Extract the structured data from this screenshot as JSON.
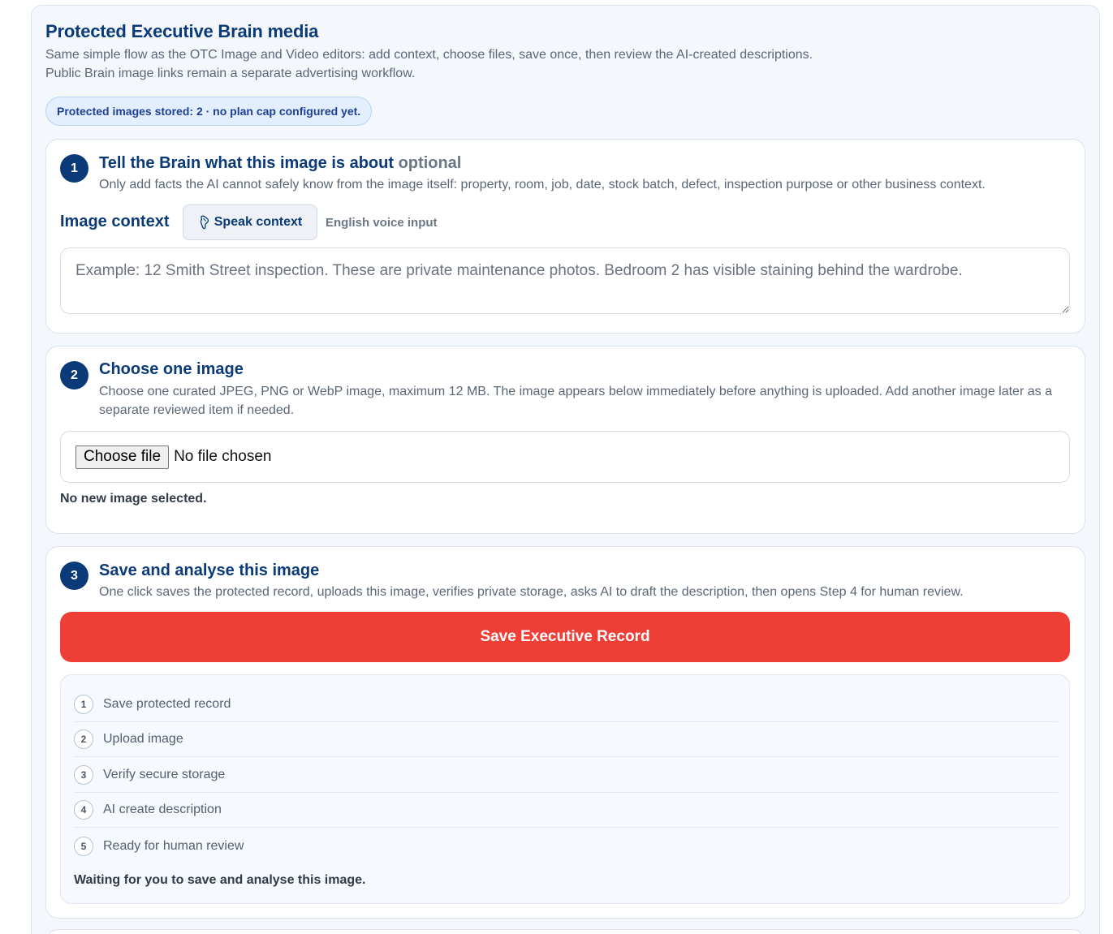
{
  "header": {
    "title": "Protected Executive Brain media",
    "intro": "Same simple flow as the OTC Image and Video editors: add context, choose files, save once, then review the AI-created descriptions. Public Brain image links remain a separate advertising workflow.",
    "status_pill": "Protected images stored: 2 · no plan cap configured yet."
  },
  "step1": {
    "number": "1",
    "title": "Tell the Brain what this image is about",
    "optional": "optional",
    "description": "Only add facts the AI cannot safely know from the image itself: property, room, job, date, stock batch, defect, inspection purpose or other business context.",
    "context_label": "Image context",
    "speak_button": "Speak context",
    "voice_label": "English voice input",
    "textarea_placeholder": "Example: 12 Smith Street inspection. These are private maintenance photos. Bedroom 2 has visible staining behind the wardrobe."
  },
  "step2": {
    "number": "2",
    "title": "Choose one image",
    "description": "Choose one curated JPEG, PNG or WebP image, maximum 12 MB. The image appears below immediately before anything is uploaded. Add another image later as a separate reviewed item if needed.",
    "file_button": "Choose file",
    "file_status": "No file chosen",
    "selection_status": "No new image selected."
  },
  "step3": {
    "number": "3",
    "title": "Save and analyse this image",
    "description": "One click saves the protected record, uploads this image, verifies private storage, asks AI to draft the description, then opens Step 4 for human review.",
    "save_button": "Save Executive Record",
    "progress": [
      {
        "num": "1",
        "label": "Save protected record"
      },
      {
        "num": "2",
        "label": "Upload image"
      },
      {
        "num": "3",
        "label": "Verify secure storage"
      },
      {
        "num": "4",
        "label": "AI create description"
      },
      {
        "num": "5",
        "label": "Ready for human review"
      }
    ],
    "waiting": "Waiting for you to save and analyse this image."
  },
  "icons": {
    "speak": "microphone-icon"
  },
  "colors": {
    "brand": "#0b3a78",
    "save_button": "#ef3e36",
    "pill_bg": "#e3efff"
  }
}
